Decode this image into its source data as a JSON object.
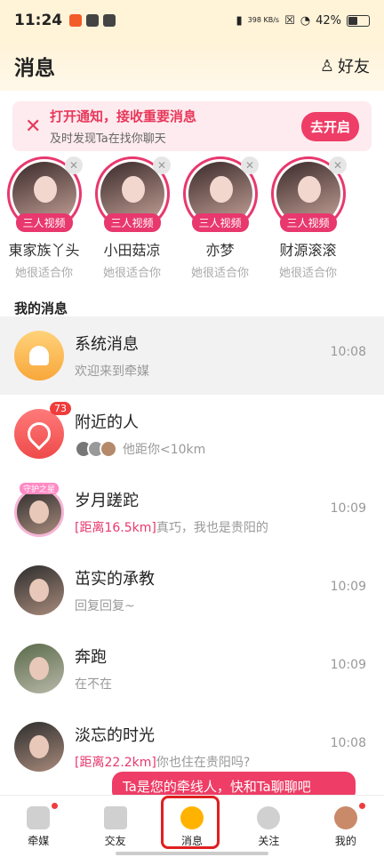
{
  "status": {
    "time": "11:24",
    "net": "398 KB/s",
    "battery": "42%"
  },
  "header": {
    "title": "消息",
    "friends": "好友"
  },
  "notice": {
    "title": "打开通知，接收重要消息",
    "subtitle": "及时发现Ta在找你聊天",
    "button": "去开启"
  },
  "recommend": [
    {
      "name": "東家族丫头",
      "tag": "三人视频",
      "sub": "她很适合你"
    },
    {
      "name": "小田菇凉",
      "tag": "三人视频",
      "sub": "她很适合你"
    },
    {
      "name": "亦梦",
      "tag": "三人视频",
      "sub": "她很适合你"
    },
    {
      "name": "财源滚滚",
      "tag": "三人视频",
      "sub": "她很适合你"
    }
  ],
  "section": "我的消息",
  "messages": [
    {
      "name": "系统消息",
      "msg": "欢迎来到牵媒",
      "time": "10:08"
    },
    {
      "name": "附近的人",
      "msg": "他距你<10km",
      "badge": "73"
    },
    {
      "name": "岁月蹉跎",
      "dist": "[距离16.5km]",
      "msg": "真巧，我也是贵阳的",
      "time": "10:09",
      "frame": "守护之星"
    },
    {
      "name": "茁实的承教",
      "msg": "回复回复~",
      "time": "10:09"
    },
    {
      "name": "奔跑",
      "msg": "在不在",
      "time": "10:09"
    },
    {
      "name": "淡忘的时光",
      "dist": "[距离22.2km]",
      "msg": "你也住在贵阳吗?",
      "time": "10:08"
    }
  ],
  "toast": "Ta是您的牵线人，快和Ta聊聊吧",
  "tabs": [
    "牵媒",
    "交友",
    "消息",
    "关注",
    "我的"
  ]
}
